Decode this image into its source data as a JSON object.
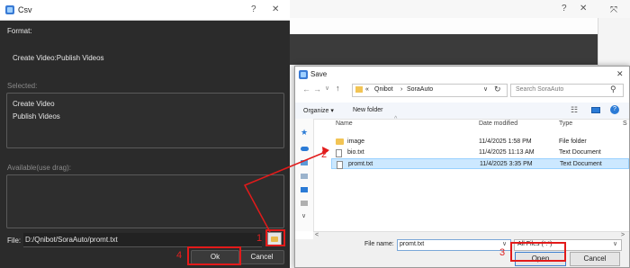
{
  "csv_dialog": {
    "title": "Csv",
    "help": "?",
    "close": "✕",
    "format_label": "Format:",
    "format_value": "Create Video:Publish Videos",
    "selected_label": "Selected:",
    "selected_items": [
      "Create Video",
      "Publish Videos"
    ],
    "available_label": "Available(use drag):",
    "file_label": "File:",
    "file_path": "D:/Qnibot/SoraAuto/promt.txt",
    "ok_label": "Ok",
    "cancel_label": "Cancel"
  },
  "background": {
    "help": "?",
    "close": "✕"
  },
  "save_dialog": {
    "title": "Save",
    "close": "✕",
    "breadcrumb": [
      "«",
      "Qnibot",
      "›",
      "SoraAuto"
    ],
    "search_placeholder": "Search SoraAuto",
    "organize_label": "Organize ▾",
    "new_folder_label": "New folder",
    "columns": [
      "Name",
      "Date modified",
      "Type",
      "S"
    ],
    "files": [
      {
        "name": "image",
        "date": "11/4/2025 1:58 PM",
        "type": "File folder",
        "icon": "folder-icon"
      },
      {
        "name": "bio.txt",
        "date": "11/4/2025 11:13 AM",
        "type": "Text Document",
        "icon": "file-icon"
      },
      {
        "name": "promt.txt",
        "date": "11/4/2025 3:35 PM",
        "type": "Text Document",
        "icon": "file-icon"
      }
    ],
    "file_name_label": "File name:",
    "file_name_value": "promt.txt",
    "file_type_value": "All Files (*.*)",
    "open_label": "Open",
    "cancel_label": "Cancel"
  },
  "annotations": [
    "1",
    "2",
    "3",
    "4"
  ],
  "colors": {
    "annotation_red": "#e21a1a",
    "selection_blue": "#cce8ff",
    "dialog_dark": "#2b2b2b"
  }
}
